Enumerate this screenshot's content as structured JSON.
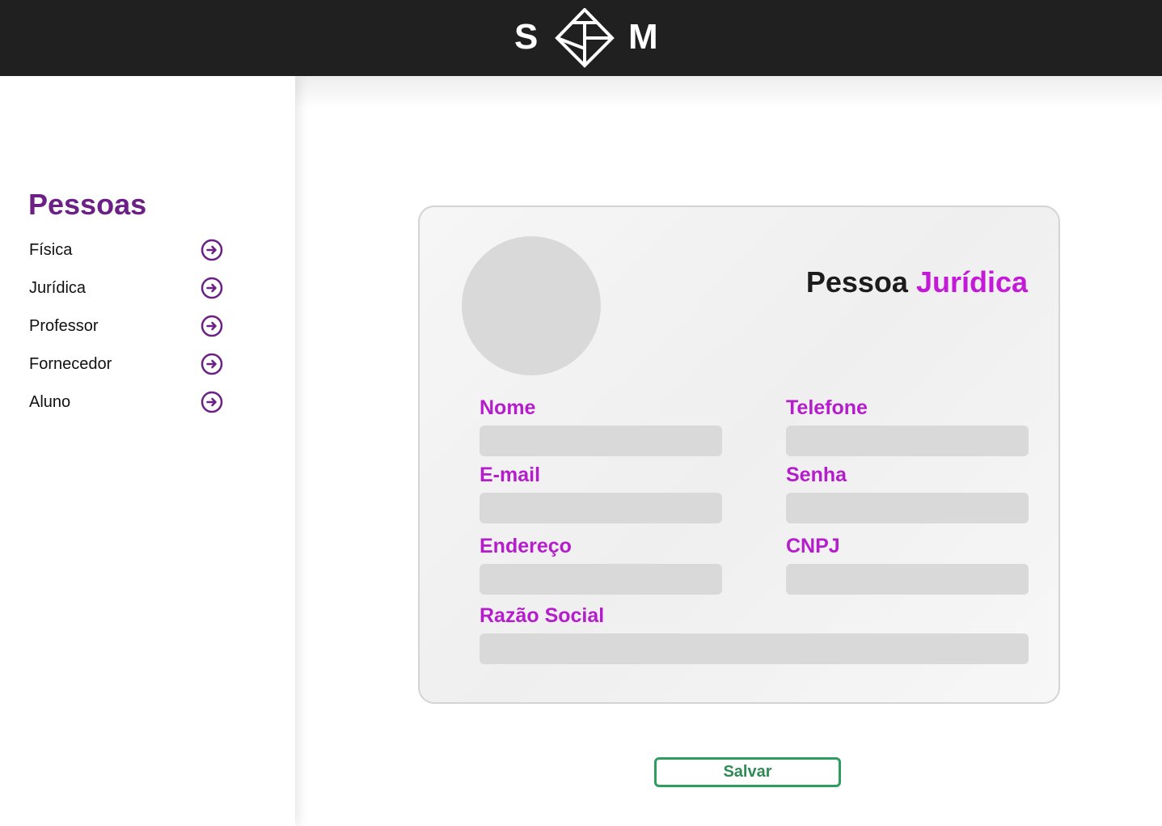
{
  "header": {
    "logo_left": "S",
    "logo_right": "M",
    "logo_mark_icon": "diamond-logo-icon"
  },
  "sidebar": {
    "title": "Pessoas",
    "items": [
      {
        "label": "Física",
        "icon": "arrow-right-circle-icon"
      },
      {
        "label": "Jurídica",
        "icon": "arrow-right-circle-icon"
      },
      {
        "label": "Professor",
        "icon": "arrow-right-circle-icon"
      },
      {
        "label": "Fornecedor",
        "icon": "arrow-right-circle-icon"
      },
      {
        "label": "Aluno",
        "icon": "arrow-right-circle-icon"
      }
    ]
  },
  "form": {
    "title_prefix": "Pessoa",
    "title_accent": "Jurídica",
    "fields": {
      "nome": {
        "label": "Nome",
        "value": ""
      },
      "telefone": {
        "label": "Telefone",
        "value": ""
      },
      "email": {
        "label": "E-mail",
        "value": ""
      },
      "senha": {
        "label": "Senha",
        "value": ""
      },
      "endereco": {
        "label": "Endereço",
        "value": ""
      },
      "cnpj": {
        "label": "CNPJ",
        "value": ""
      },
      "razao_social": {
        "label": "Razão Social",
        "value": ""
      }
    },
    "save_label": "Salvar"
  },
  "colors": {
    "header_bg": "#202020",
    "sidebar_title": "#6c1f85",
    "label_accent": "#b51ccb",
    "title_accent": "#c21ad6",
    "save_border": "#2f9d5d",
    "input_bg": "#d9d9d9"
  }
}
